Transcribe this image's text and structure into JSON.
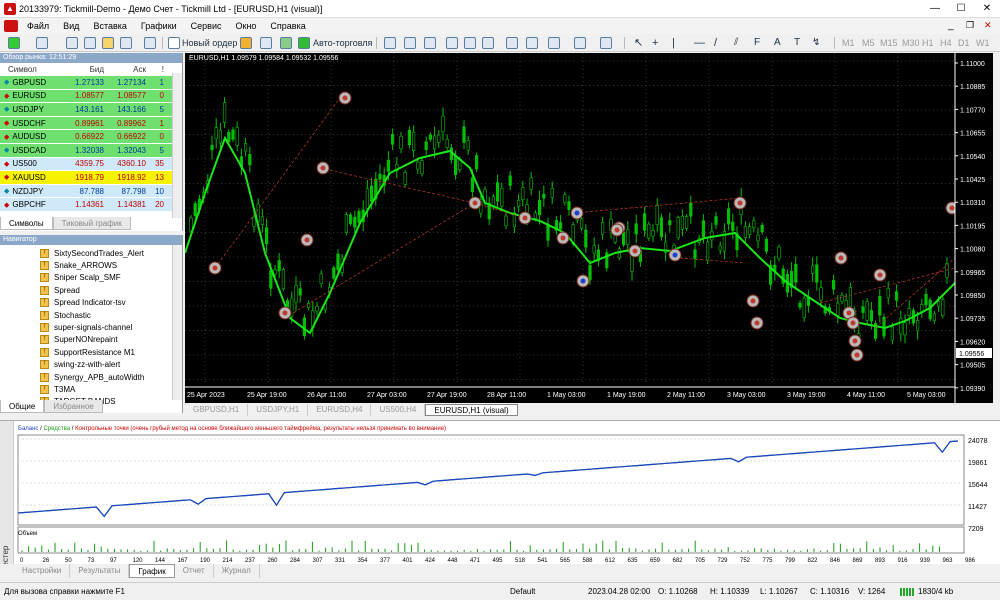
{
  "window": {
    "title": "20133979: Tickmill-Demo - Демо Счет - Tickmill Ltd - [EURUSD,H1 (visual)]"
  },
  "menu": [
    "Файл",
    "Вид",
    "Вставка",
    "Графики",
    "Сервис",
    "Окно",
    "Справка"
  ],
  "toolbar": {
    "new_order": "Новый ордер",
    "autotrade": "Авто-торговля",
    "timeframes": [
      "M1",
      "M5",
      "M15",
      "M30",
      "H1",
      "H4",
      "D1",
      "W1",
      "MN"
    ]
  },
  "market_watch": {
    "title": "Обзор рынка: 12:51:29",
    "columns": [
      "Символ",
      "Бид",
      "Аск",
      "!"
    ],
    "rows": [
      {
        "symbol": "GBPUSD",
        "bid": "1.27133",
        "ask": "1.27134",
        "spread": "1",
        "dir": "up",
        "bg": "#6fe06f",
        "tc": "#003a9a"
      },
      {
        "symbol": "EURUSD",
        "bid": "1.08577",
        "ask": "1.08577",
        "spread": "0",
        "dir": "down",
        "bg": "#6fe06f",
        "tc": "#c00000"
      },
      {
        "symbol": "USDJPY",
        "bid": "143.161",
        "ask": "143.166",
        "spread": "5",
        "dir": "up",
        "bg": "#6fe06f",
        "tc": "#003a9a"
      },
      {
        "symbol": "USDCHF",
        "bid": "0.89961",
        "ask": "0.89962",
        "spread": "1",
        "dir": "down",
        "bg": "#6fe06f",
        "tc": "#c00000"
      },
      {
        "symbol": "AUDUSD",
        "bid": "0.66922",
        "ask": "0.66922",
        "spread": "0",
        "dir": "down",
        "bg": "#6fe06f",
        "tc": "#c00000"
      },
      {
        "symbol": "USDCAD",
        "bid": "1.32038",
        "ask": "1.32043",
        "spread": "5",
        "dir": "up",
        "bg": "#6fe06f",
        "tc": "#003a9a"
      },
      {
        "symbol": "US500",
        "bid": "4359.75",
        "ask": "4360.10",
        "spread": "35",
        "dir": "down",
        "bg": "#cfe9f8",
        "tc": "#c00000"
      },
      {
        "symbol": "XAUUSD",
        "bid": "1918.79",
        "ask": "1918.92",
        "spread": "13",
        "dir": "down",
        "bg": "#f7f200",
        "tc": "#c00000"
      },
      {
        "symbol": "NZDJPY",
        "bid": "87.788",
        "ask": "87.798",
        "spread": "10",
        "dir": "up",
        "bg": "#cfe9f8",
        "tc": "#003a9a"
      },
      {
        "symbol": "GBPCHF",
        "bid": "1.14361",
        "ask": "1.14381",
        "spread": "20",
        "dir": "down",
        "bg": "#cfe9f8",
        "tc": "#c00000"
      }
    ],
    "tabs": [
      "Символы",
      "Тиковый график"
    ]
  },
  "navigator": {
    "title": "Навигатор",
    "items": [
      "SixtySecondTrades_Alert",
      "Snake_ARROWS",
      "Sniper Scalp_SMF",
      "Spread",
      "Spread Indicator-tsv",
      "Stochastic",
      "super-signals-channel",
      "SuperNONrepaint",
      "SupportResistance M1",
      "swing-zz-with-alert",
      "Synergy_APB_autoWidth",
      "T3MA",
      "TARGET BANDS"
    ],
    "tabs": [
      "Общие",
      "Избранное"
    ]
  },
  "chart": {
    "header": "EURUSD,H1  1.09579 1.09584 1.09532 1.09556",
    "price_labels": [
      "1.11000",
      "1.10885",
      "1.10770",
      "1.10655",
      "1.10540",
      "1.10425",
      "1.10310",
      "1.10195",
      "1.10080",
      "1.09965",
      "1.09850",
      "1.09735",
      "1.09620",
      "1.09505",
      "1.09390"
    ],
    "current_price": "1.09556",
    "time_labels": [
      "25 Apr 2023",
      "25 Apr 19:00",
      "26 Apr 11:00",
      "27 Apr 03:00",
      "27 Apr 19:00",
      "28 Apr 11:00",
      "1 May 03:00",
      "1 May 19:00",
      "2 May 11:00",
      "3 May 03:00",
      "3 May 19:00",
      "4 May 11:00",
      "5 May 03:00"
    ],
    "tabs": [
      "GBPUSD,H1",
      "USDJPY,H1",
      "EURUSD,H4",
      "US500,H4",
      "EURUSD,H1 (visual)"
    ],
    "active_tab": 4,
    "colors": {
      "bull": "#00c000",
      "ma": "#19e619",
      "sell": "#c0392b",
      "buy": "#1e3fcf",
      "bg": "#000000"
    }
  },
  "tester": {
    "legend_balance": "Баланс",
    "legend_equity": "Средства",
    "legend_note": "Контрольные точки (очень грубый метод на основе ближайшего меньшего таймфрейма, результаты нельзя принимать во внимание)",
    "y_labels": [
      "24078",
      "19861",
      "15644",
      "11427",
      "7209"
    ],
    "volume_label": "Объем",
    "x_labels": [
      "0",
      "26",
      "50",
      "73",
      "97",
      "120",
      "144",
      "167",
      "190",
      "214",
      "237",
      "260",
      "284",
      "307",
      "331",
      "354",
      "377",
      "401",
      "424",
      "448",
      "471",
      "495",
      "518",
      "541",
      "565",
      "588",
      "612",
      "635",
      "659",
      "682",
      "705",
      "729",
      "752",
      "775",
      "799",
      "822",
      "846",
      "869",
      "893",
      "916",
      "939",
      "963",
      "986"
    ],
    "side_label": "Тестер",
    "tabs": [
      "Настройки",
      "Результаты",
      "График",
      "Отчет",
      "Журнал"
    ],
    "active_tab": 2
  },
  "status": {
    "help": "Для вызова справки нажмите F1",
    "profile": "Default",
    "datetime": "2023.04.28 02:00",
    "open": "O: 1.10268",
    "high": "H: 1.10339",
    "low": "L: 1.10267",
    "close": "C: 1.10316",
    "volume": "V: 1264",
    "traffic": "1830/4 kb"
  }
}
